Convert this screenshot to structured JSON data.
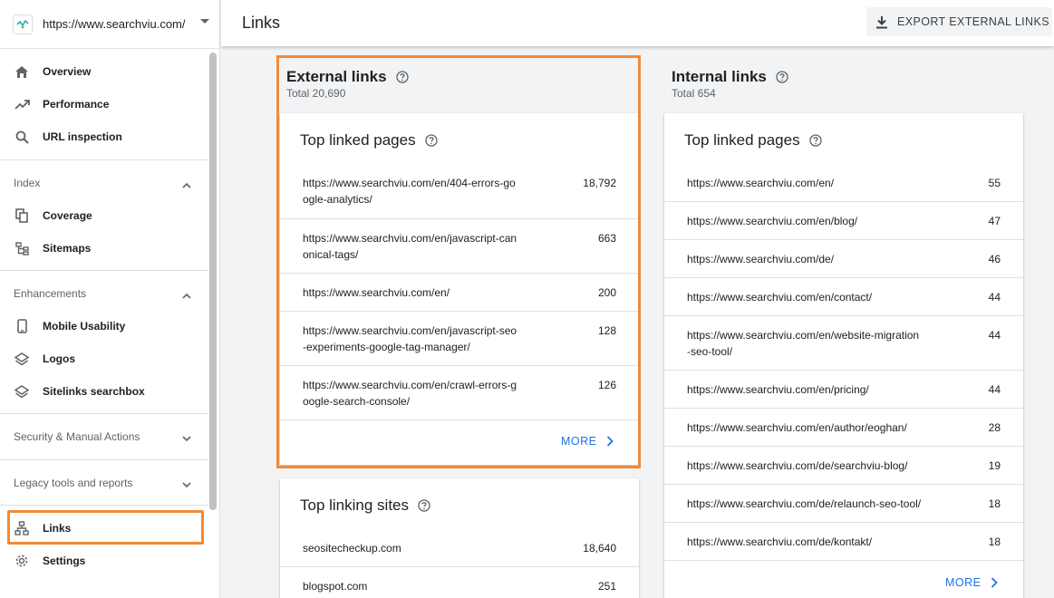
{
  "property": {
    "url": "https://www.searchviu.com/"
  },
  "nav": {
    "overview": "Overview",
    "performance": "Performance",
    "url_inspection": "URL inspection",
    "index_header": "Index",
    "coverage": "Coverage",
    "sitemaps": "Sitemaps",
    "enhancements_header": "Enhancements",
    "mobile_usability": "Mobile Usability",
    "logos": "Logos",
    "sitelinks_searchbox": "Sitelinks searchbox",
    "security_header": "Security & Manual Actions",
    "legacy_header": "Legacy tools and reports",
    "links": "Links",
    "settings": "Settings"
  },
  "header": {
    "title": "Links",
    "export_label": "EXPORT EXTERNAL LINKS"
  },
  "external": {
    "title": "External links",
    "total": "Total 20,690",
    "top_linked_pages": {
      "title": "Top linked pages",
      "rows": [
        {
          "url1": "https://www.searchviu.com/en/404-errors-go",
          "url2": "ogle-analytics/",
          "count": "18,792"
        },
        {
          "url1": "https://www.searchviu.com/en/javascript-can",
          "url2": "onical-tags/",
          "count": "663"
        },
        {
          "url1": "https://www.searchviu.com/en/",
          "url2": "",
          "count": "200"
        },
        {
          "url1": "https://www.searchviu.com/en/javascript-seo",
          "url2": "-experiments-google-tag-manager/",
          "count": "128"
        },
        {
          "url1": "https://www.searchviu.com/en/crawl-errors-g",
          "url2": "oogle-search-console/",
          "count": "126"
        }
      ],
      "more": "MORE"
    },
    "top_linking_sites": {
      "title": "Top linking sites",
      "rows": [
        {
          "site": "seositecheckup.com",
          "count": "18,640"
        },
        {
          "site": "blogspot.com",
          "count": "251"
        }
      ]
    }
  },
  "internal": {
    "title": "Internal links",
    "total": "Total 654",
    "top_linked_pages": {
      "title": "Top linked pages",
      "rows": [
        {
          "url1": "https://www.searchviu.com/en/",
          "url2": "",
          "count": "55"
        },
        {
          "url1": "https://www.searchviu.com/en/blog/",
          "url2": "",
          "count": "47"
        },
        {
          "url1": "https://www.searchviu.com/de/",
          "url2": "",
          "count": "46"
        },
        {
          "url1": "https://www.searchviu.com/en/contact/",
          "url2": "",
          "count": "44"
        },
        {
          "url1": "https://www.searchviu.com/en/website-migration",
          "url2": "-seo-tool/",
          "count": "44"
        },
        {
          "url1": "https://www.searchviu.com/en/pricing/",
          "url2": "",
          "count": "44"
        },
        {
          "url1": "https://www.searchviu.com/en/author/eoghan/",
          "url2": "",
          "count": "28"
        },
        {
          "url1": "https://www.searchviu.com/de/searchviu-blog/",
          "url2": "",
          "count": "19"
        },
        {
          "url1": "https://www.searchviu.com/de/relaunch-seo-tool/",
          "url2": "",
          "count": "18"
        },
        {
          "url1": "https://www.searchviu.com/de/kontakt/",
          "url2": "",
          "count": "18"
        }
      ],
      "more": "MORE"
    }
  },
  "colors": {
    "accent": "#1a73e8",
    "highlight": "#f28a35"
  }
}
